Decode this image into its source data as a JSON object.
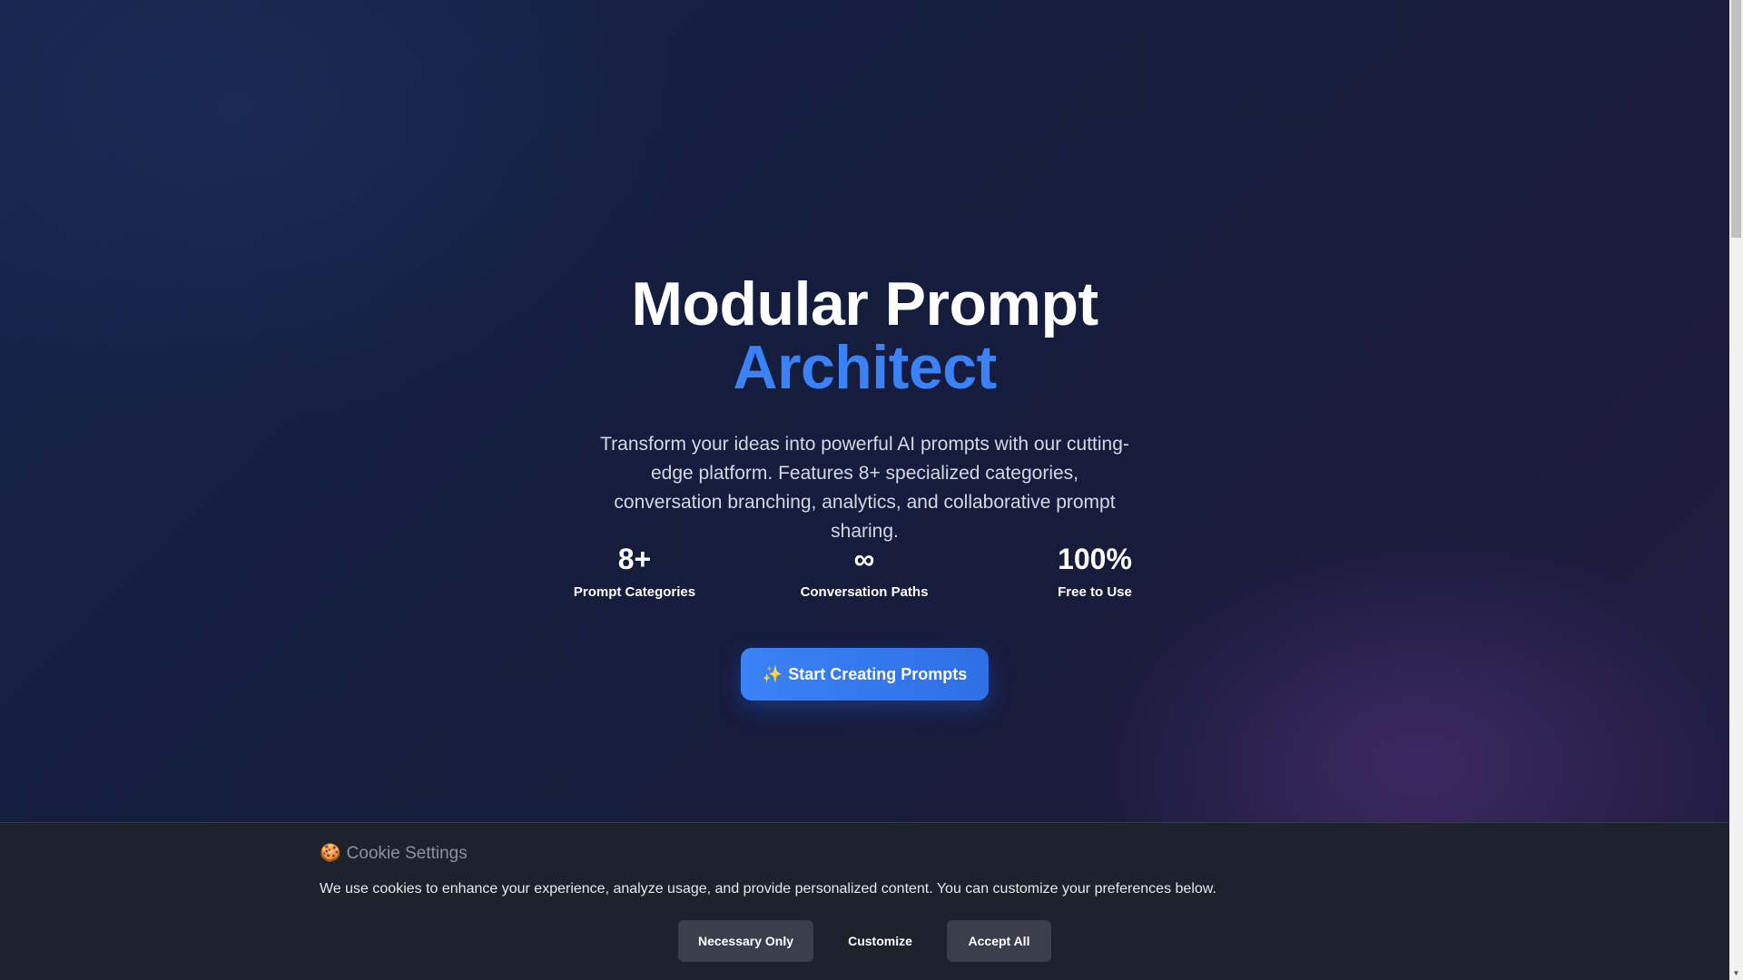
{
  "hero": {
    "title_line1": "Modular Prompt",
    "title_line2": "Architect",
    "subtitle": "Transform your ideas into powerful AI prompts with our cutting-edge platform. Features 8+ specialized categories, conversation branching, analytics, and collaborative prompt sharing.",
    "accent_color": "#3b82f6"
  },
  "stats": [
    {
      "value": "8+",
      "label": "Prompt Categories"
    },
    {
      "value": "∞",
      "label": "Conversation Paths"
    },
    {
      "value": "100%",
      "label": "Free to Use"
    }
  ],
  "cta": {
    "icon": "sparkles-icon",
    "icon_glyph": "✨",
    "label": "Start Creating Prompts"
  },
  "cookie_banner": {
    "icon": "cookie-icon",
    "icon_glyph": "🍪",
    "title": "Cookie Settings",
    "text": "We use cookies to enhance your experience, analyze usage, and provide personalized content. You can customize your preferences below.",
    "buttons": {
      "necessary": "Necessary Only",
      "customize": "Customize",
      "accept": "Accept All"
    }
  },
  "scrollbar": {
    "arrow_glyph": "▼"
  }
}
